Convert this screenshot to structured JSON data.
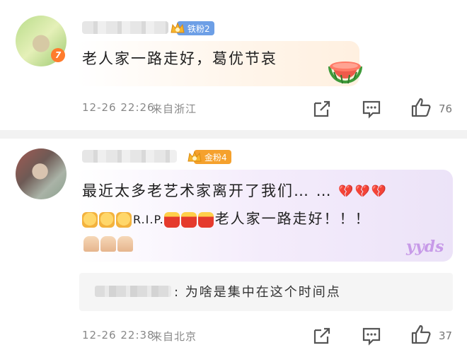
{
  "comments": [
    {
      "level_tag": "7",
      "fan_badge": "铁粉2",
      "text": "老人家一路走好，葛优节哀",
      "time": "12-26 22:26",
      "location": "来自浙江",
      "likes": "76"
    },
    {
      "fan_badge": "金粉4",
      "text_line1": "最近太多老艺术家离开了我们…  …",
      "text_line2_rip": "R.I.P.",
      "text_line2_end": "老人家一路走好！！！",
      "reply_text": "为啥是集中在这个时间点",
      "time": "12-26 22:38",
      "location": "来自北京",
      "likes": "37",
      "sticker": "yyds"
    }
  ],
  "icons": {
    "share": "share-icon",
    "comment": "comment-icon",
    "like": "thumbs-up-icon"
  },
  "colors": {
    "iron_badge": "#6d9fe6",
    "gold_badge": "#f5a12d"
  }
}
